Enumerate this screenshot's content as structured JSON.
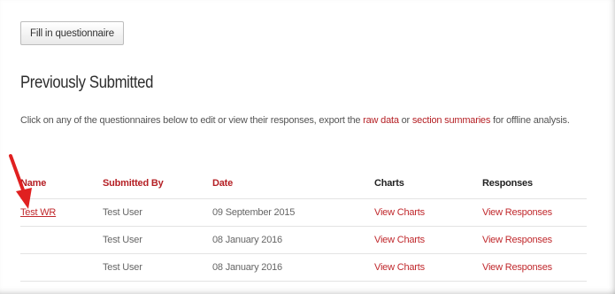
{
  "toolbar": {
    "fill_label": "Fill in questionnaire"
  },
  "section": {
    "title": "Previously Submitted",
    "intro_pre": "Click on any of the questionnaires below to edit or view their responses, export the ",
    "raw_data": "raw data",
    "intro_mid": " or ",
    "section_summaries": "section summaries",
    "intro_post": " for offline analysis."
  },
  "table": {
    "headers": {
      "name": "Name",
      "submitted_by": "Submitted By",
      "date": "Date",
      "charts": "Charts",
      "responses": "Responses"
    },
    "rows": [
      {
        "name": "Test WR",
        "submitted_by": "Test User",
        "date": "09 September 2015",
        "charts": "View Charts",
        "responses": "View Responses"
      },
      {
        "name": "",
        "submitted_by": "Test User",
        "date": "08 January 2016",
        "charts": "View Charts",
        "responses": "View Responses"
      },
      {
        "name": "",
        "submitted_by": "Test User",
        "date": "08 January 2016",
        "charts": "View Charts",
        "responses": "View Responses"
      }
    ]
  },
  "annotation": {
    "icon": "red-arrow-icon",
    "color": "#e02020"
  },
  "colors": {
    "accent": "#b52025",
    "link": "#c0282c"
  }
}
